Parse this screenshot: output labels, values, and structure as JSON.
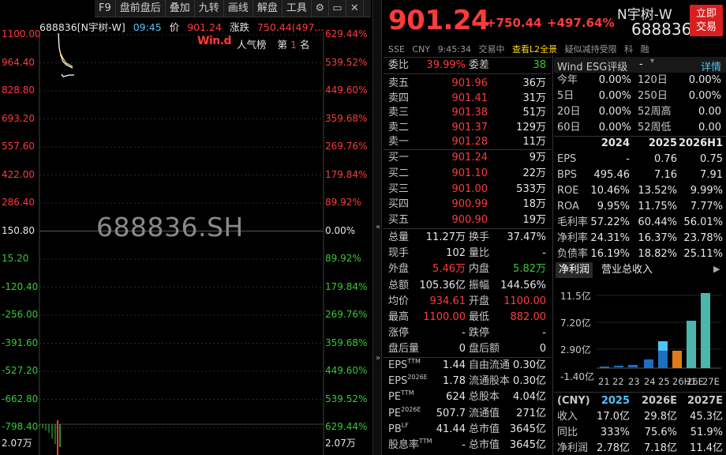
{
  "toolbar": {
    "items": [
      "F9",
      "盘前盘后",
      "叠加",
      "九转",
      "画线",
      "解盘",
      "工具"
    ]
  },
  "chart": {
    "header": {
      "code_name": "688836[N宇树-W]",
      "time": "09:45",
      "price_label": "价",
      "price": "901.24",
      "change_label": "涨跌",
      "change": "750.44(497..."
    },
    "wind_badge": "Win.d",
    "rank_text": "人气榜",
    "rank_prefix": "第",
    "rank_num": "1",
    "rank_suffix": "名",
    "watermark": "688836.SH",
    "y_left": [
      "1100.00",
      "964.40",
      "828.80",
      "693.20",
      "557.60",
      "422.00",
      "286.40",
      "150.80",
      "15.20",
      "-120.40",
      "-256.00",
      "-391.60",
      "-527.20",
      "-662.80",
      "-798.40",
      "2.07万"
    ],
    "y_right": [
      "629.44%",
      "539.52%",
      "449.60%",
      "359.68%",
      "269.76%",
      "179.84%",
      "89.92%",
      "0.00%",
      "89.92%",
      "179.84%",
      "269.76%",
      "359.68%",
      "449.60%",
      "539.52%",
      "629.44%",
      "2.07万"
    ]
  },
  "quote": {
    "price": "901.24",
    "change": "+750.44",
    "pct": "+497.64%",
    "name": "N宇树-W",
    "code": "688836",
    "buy_button": [
      "立即",
      "交易"
    ],
    "meta": [
      "SSE",
      "CNY",
      "9:45:34",
      "交易中",
      "查看L2全景",
      "疑似减持受限",
      "科",
      "融"
    ],
    "commission": {
      "ratio_label": "委比",
      "ratio": "39.99%",
      "diff_label": "委差",
      "diff": "38"
    },
    "asks": [
      {
        "label": "卖五",
        "price": "901.96",
        "vol": "36万"
      },
      {
        "label": "卖四",
        "price": "901.41",
        "vol": "31万"
      },
      {
        "label": "卖三",
        "price": "901.38",
        "vol": "51万"
      },
      {
        "label": "卖二",
        "price": "901.37",
        "vol": "129万"
      },
      {
        "label": "卖一",
        "price": "901.28",
        "vol": "11万"
      }
    ],
    "bids": [
      {
        "label": "买一",
        "price": "901.24",
        "vol": "9万"
      },
      {
        "label": "买二",
        "price": "901.10",
        "vol": "22万"
      },
      {
        "label": "买三",
        "price": "901.00",
        "vol": "533万"
      },
      {
        "label": "买四",
        "price": "900.99",
        "vol": "18万"
      },
      {
        "label": "买五",
        "price": "900.90",
        "vol": "19万"
      }
    ],
    "stats": [
      {
        "l1": "总量",
        "v1": "11.27万",
        "c1": "white",
        "l2": "换手",
        "v2": "37.47%",
        "c2": "white"
      },
      {
        "l1": "现手",
        "v1": "102",
        "c1": "white",
        "l2": "量比",
        "v2": "-",
        "c2": "white"
      },
      {
        "l1": "外盘",
        "v1": "5.46万",
        "c1": "red",
        "l2": "内盘",
        "v2": "5.82万",
        "c2": "green"
      },
      {
        "l1": "总额",
        "v1": "105.36亿",
        "c1": "white",
        "l2": "振幅",
        "v2": "144.56%",
        "c2": "white"
      },
      {
        "l1": "均价",
        "v1": "934.61",
        "c1": "red",
        "l2": "开盘",
        "v2": "1100.00",
        "c2": "red"
      },
      {
        "l1": "最高",
        "v1": "1100.00",
        "c1": "red",
        "l2": "最低",
        "v2": "882.00",
        "c2": "red"
      },
      {
        "l1": "涨停",
        "v1": "-",
        "c1": "white",
        "l2": "跌停",
        "v2": "-",
        "c2": "white"
      },
      {
        "l1": "盘后量",
        "v1": "0",
        "c1": "white",
        "l2": "盘后额",
        "v2": "0",
        "c2": "white"
      }
    ],
    "valuation": [
      {
        "l1": "EPS",
        "s1": "TTM",
        "v1": "1.44",
        "l2": "自由流通",
        "v2": "0.30亿"
      },
      {
        "l1": "EPS",
        "s1": "2026E",
        "v1": "1.78",
        "l2": "流通股本",
        "v2": "0.30亿"
      },
      {
        "l1": "PE",
        "s1": "TTM",
        "v1": "624",
        "l2": "总股本",
        "v2": "4.04亿"
      },
      {
        "l1": "PE",
        "s1": "2026E",
        "v1": "507.7",
        "l2": "流通值",
        "v2": "271亿"
      },
      {
        "l1": "PB",
        "s1": "LF",
        "v1": "41.44",
        "l2": "总市值",
        "v2": "3645亿"
      },
      {
        "l1": "股息率",
        "s1": "TTM",
        "v1": "-",
        "l2": "总市值",
        "v2": "3645亿"
      }
    ]
  },
  "side": {
    "esg_label": "Wind ESG评级",
    "esg_value": "-",
    "detail_link": "详情",
    "periods": [
      {
        "a": "今年",
        "av": "0.00%",
        "b": "120日",
        "bv": "0.00%"
      },
      {
        "a": "5日",
        "av": "0.00%",
        "b": "250日",
        "bv": "0.00%"
      },
      {
        "a": "20日",
        "av": "0.00%",
        "b": "52周高",
        "bv": "0.00"
      },
      {
        "a": "60日",
        "av": "0.00%",
        "b": "52周低",
        "bv": "0.00"
      }
    ],
    "fin_header": [
      "",
      "2024",
      "2025",
      "2026H1"
    ],
    "fin_rows": [
      {
        "k": "EPS",
        "v": [
          "-",
          "0.76",
          "0.75"
        ]
      },
      {
        "k": "BPS",
        "v": [
          "495.46",
          "7.16",
          "7.91"
        ]
      },
      {
        "k": "ROE",
        "v": [
          "10.46%",
          "13.52%",
          "9.99%"
        ]
      },
      {
        "k": "ROA",
        "v": [
          "9.95%",
          "11.75%",
          "7.77%"
        ]
      },
      {
        "k": "毛利率",
        "v": [
          "57.22%",
          "60.44%",
          "56.01%"
        ]
      },
      {
        "k": "净利率",
        "v": [
          "24.31%",
          "16.37%",
          "23.78%"
        ]
      },
      {
        "k": "负债率",
        "v": [
          "16.19%",
          "18.82%",
          "25.11%"
        ]
      }
    ],
    "tabs": [
      "净利润",
      "营业总收入"
    ],
    "mini_chart": {
      "y_labels": [
        "11.5亿",
        "7.20亿",
        "2.90亿",
        "-1.40亿"
      ],
      "x_labels": [
        "21",
        "22",
        "23",
        "24",
        "25",
        "26H1",
        "26E",
        "27E"
      ]
    },
    "forecast_header": [
      "(CNY)",
      "2025",
      "2026E",
      "2027E"
    ],
    "forecast_rows": [
      {
        "k": "收入",
        "v": [
          "17.0亿",
          "29.8亿",
          "45.3亿"
        ],
        "c": "white"
      },
      {
        "k": "同比",
        "v": [
          "333%",
          "75.6%",
          "51.9%"
        ],
        "c": "red"
      },
      {
        "k": "净利润",
        "v": [
          "2.78亿",
          "7.18亿",
          "11.4亿"
        ],
        "c": "white"
      }
    ]
  }
}
